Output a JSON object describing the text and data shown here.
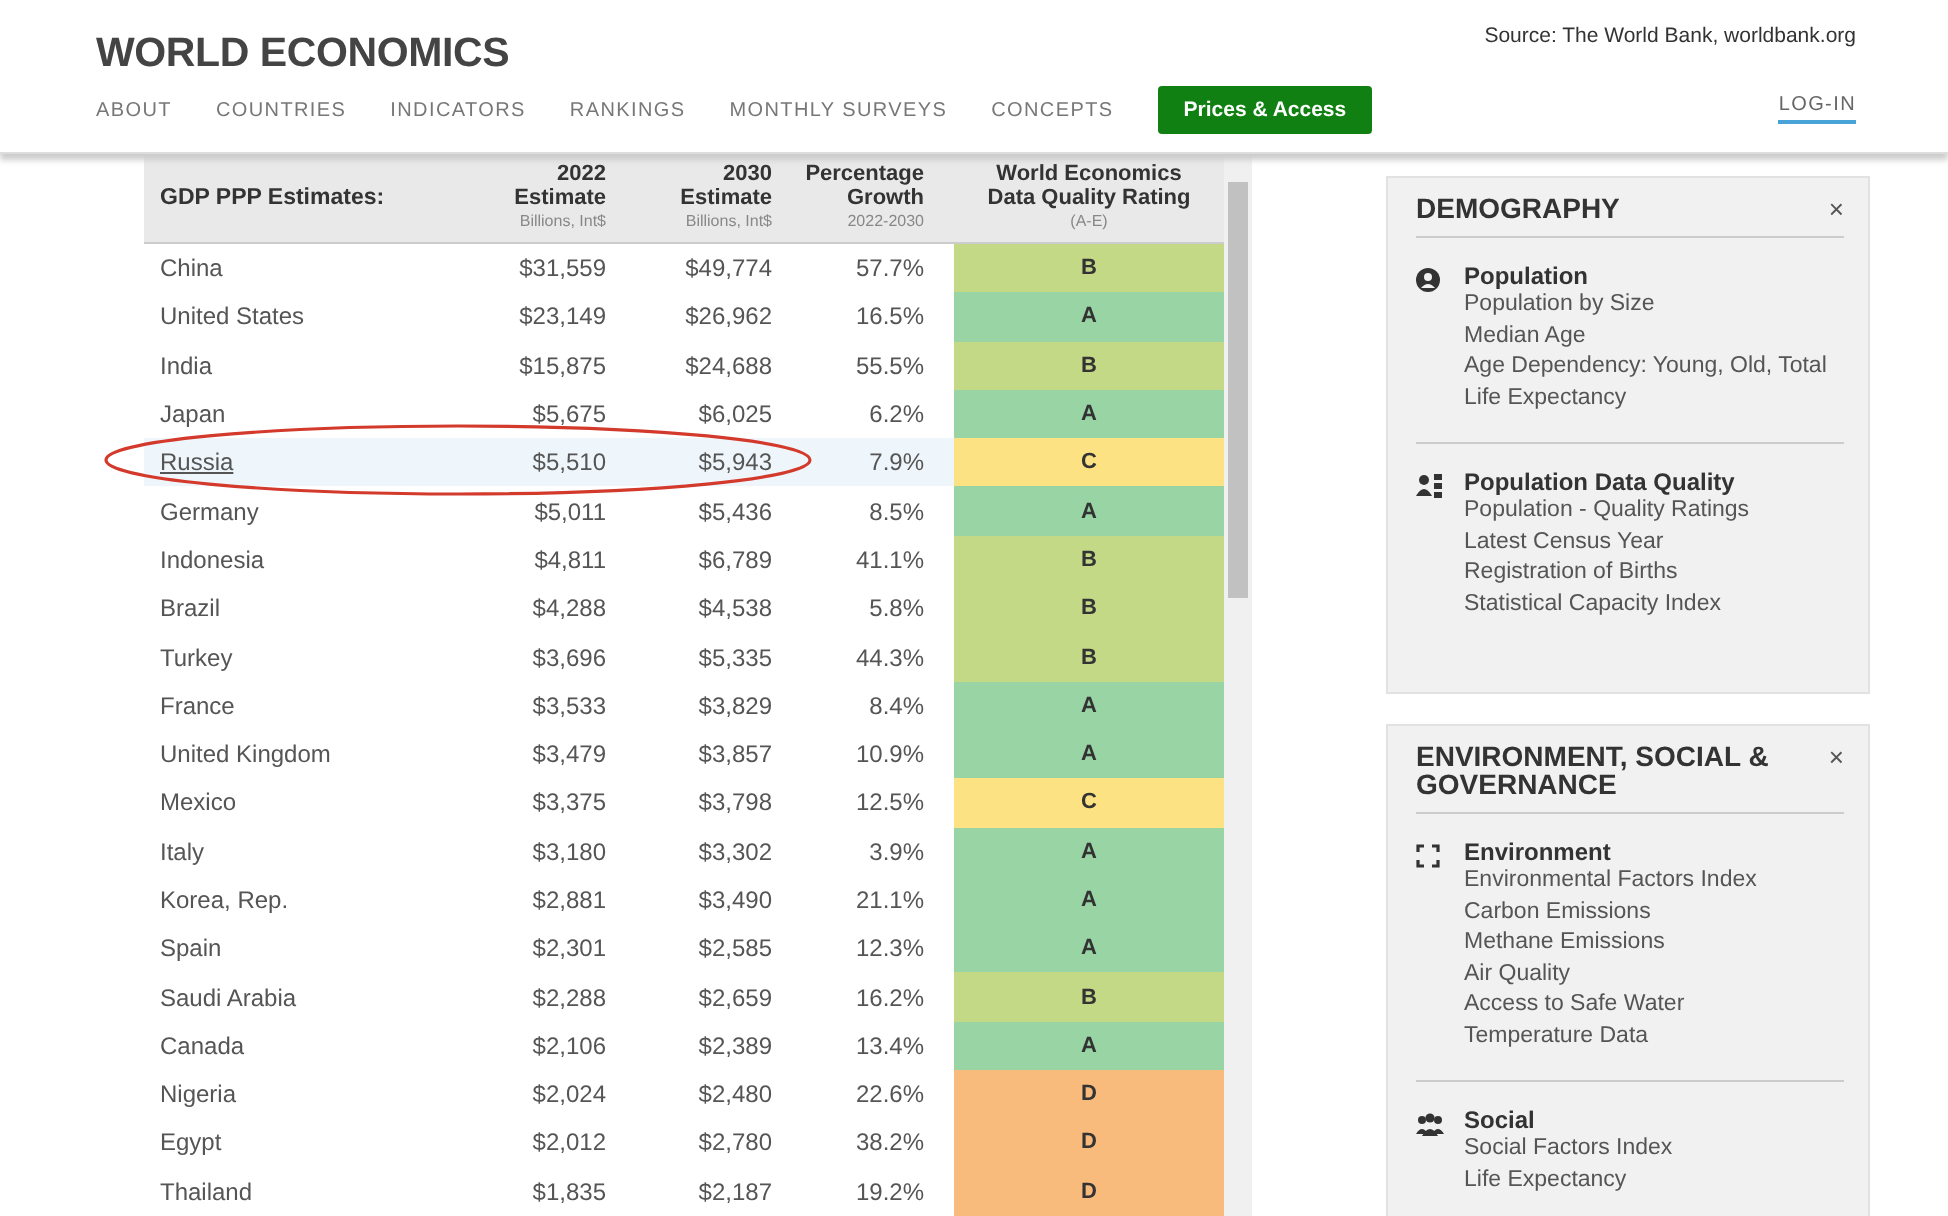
{
  "header": {
    "logo": "WORLD ECONOMICS",
    "source": "Source: The World Bank, worldbank.org",
    "nav": [
      "ABOUT",
      "COUNTRIES",
      "INDICATORS",
      "RANKINGS",
      "MONTHLY SURVEYS",
      "CONCEPTS"
    ],
    "cta": "Prices & Access",
    "login": "LOG-IN"
  },
  "table": {
    "title": "GDP PPP Estimates:",
    "columns": [
      {
        "lines": [
          "2022",
          "Estimate"
        ],
        "sub": "Billions, Int$"
      },
      {
        "lines": [
          "2030",
          "Estimate"
        ],
        "sub": "Billions, Int$"
      },
      {
        "lines": [
          "Percentage",
          "Growth"
        ],
        "sub": "2022-2030"
      },
      {
        "lines": [
          "World Economics",
          "Data Quality Rating"
        ],
        "sub": "(A-E)"
      }
    ],
    "rows": [
      {
        "country": "China",
        "e2022": "$31,559",
        "e2030": "$49,774",
        "growth": "57.7%",
        "rating": "B",
        "color": "#c4d985",
        "selected": false,
        "circled": false
      },
      {
        "country": "United States",
        "e2022": "$23,149",
        "e2030": "$26,962",
        "growth": "16.5%",
        "rating": "A",
        "color": "#98d4a4",
        "selected": false,
        "circled": false
      },
      {
        "country": "India",
        "e2022": "$15,875",
        "e2030": "$24,688",
        "growth": "55.5%",
        "rating": "B",
        "color": "#c4d985",
        "selected": false,
        "circled": false
      },
      {
        "country": "Japan",
        "e2022": "$5,675",
        "e2030": "$6,025",
        "growth": "6.2%",
        "rating": "A",
        "color": "#98d4a4",
        "selected": false,
        "circled": false
      },
      {
        "country": "Russia",
        "e2022": "$5,510",
        "e2030": "$5,943",
        "growth": "7.9%",
        "rating": "C",
        "color": "#fde283",
        "selected": true,
        "circled": true
      },
      {
        "country": "Germany",
        "e2022": "$5,011",
        "e2030": "$5,436",
        "growth": "8.5%",
        "rating": "A",
        "color": "#98d4a4",
        "selected": false,
        "circled": false
      },
      {
        "country": "Indonesia",
        "e2022": "$4,811",
        "e2030": "$6,789",
        "growth": "41.1%",
        "rating": "B",
        "color": "#c4d985",
        "selected": false,
        "circled": false
      },
      {
        "country": "Brazil",
        "e2022": "$4,288",
        "e2030": "$4,538",
        "growth": "5.8%",
        "rating": "B",
        "color": "#c4d985",
        "selected": false,
        "circled": false
      },
      {
        "country": "Turkey",
        "e2022": "$3,696",
        "e2030": "$5,335",
        "growth": "44.3%",
        "rating": "B",
        "color": "#c4d985",
        "selected": false,
        "circled": false
      },
      {
        "country": "France",
        "e2022": "$3,533",
        "e2030": "$3,829",
        "growth": "8.4%",
        "rating": "A",
        "color": "#98d4a4",
        "selected": false,
        "circled": false
      },
      {
        "country": "United Kingdom",
        "e2022": "$3,479",
        "e2030": "$3,857",
        "growth": "10.9%",
        "rating": "A",
        "color": "#98d4a4",
        "selected": false,
        "circled": false
      },
      {
        "country": "Mexico",
        "e2022": "$3,375",
        "e2030": "$3,798",
        "growth": "12.5%",
        "rating": "C",
        "color": "#fde283",
        "selected": false,
        "circled": false
      },
      {
        "country": "Italy",
        "e2022": "$3,180",
        "e2030": "$3,302",
        "growth": "3.9%",
        "rating": "A",
        "color": "#98d4a4",
        "selected": false,
        "circled": false
      },
      {
        "country": "Korea, Rep.",
        "e2022": "$2,881",
        "e2030": "$3,490",
        "growth": "21.1%",
        "rating": "A",
        "color": "#98d4a4",
        "selected": false,
        "circled": false
      },
      {
        "country": "Spain",
        "e2022": "$2,301",
        "e2030": "$2,585",
        "growth": "12.3%",
        "rating": "A",
        "color": "#98d4a4",
        "selected": false,
        "circled": false
      },
      {
        "country": "Saudi Arabia",
        "e2022": "$2,288",
        "e2030": "$2,659",
        "growth": "16.2%",
        "rating": "B",
        "color": "#c4d985",
        "selected": false,
        "circled": false
      },
      {
        "country": "Canada",
        "e2022": "$2,106",
        "e2030": "$2,389",
        "growth": "13.4%",
        "rating": "A",
        "color": "#98d4a4",
        "selected": false,
        "circled": false
      },
      {
        "country": "Nigeria",
        "e2022": "$2,024",
        "e2030": "$2,480",
        "growth": "22.6%",
        "rating": "D",
        "color": "#f8bb7b",
        "selected": false,
        "circled": false
      },
      {
        "country": "Egypt",
        "e2022": "$2,012",
        "e2030": "$2,780",
        "growth": "38.2%",
        "rating": "D",
        "color": "#f8bb7b",
        "selected": false,
        "circled": false
      },
      {
        "country": "Thailand",
        "e2022": "$1,835",
        "e2030": "$2,187",
        "growth": "19.2%",
        "rating": "D",
        "color": "#f8bb7b",
        "selected": false,
        "circled": false
      }
    ]
  },
  "panels": [
    {
      "title": [
        "DEMOGRAPHY"
      ],
      "close": "×",
      "groups": [
        {
          "kind": "person",
          "heading": "Population",
          "links": [
            "Population by Size",
            "Median Age",
            "Age Dependency: Young, Old, Total",
            "Life Expectancy"
          ]
        },
        {
          "kind": "quality",
          "heading": "Population Data Quality",
          "links": [
            "Population - Quality Ratings",
            "Latest Census Year",
            "Registration of Births",
            "Statistical Capacity Index"
          ]
        }
      ]
    },
    {
      "title": [
        "ENVIRONMENT, SOCIAL &",
        "GOVERNANCE"
      ],
      "close": "×",
      "groups": [
        {
          "kind": "environment",
          "heading": "Environment",
          "links": [
            "Environmental Factors Index",
            "Carbon Emissions",
            "Methane Emissions",
            "Air Quality",
            "Access to Safe Water",
            "Temperature Data"
          ]
        },
        {
          "kind": "social",
          "heading": "Social",
          "links": [
            "Social Factors Index",
            "Life Expectancy"
          ]
        }
      ]
    }
  ]
}
